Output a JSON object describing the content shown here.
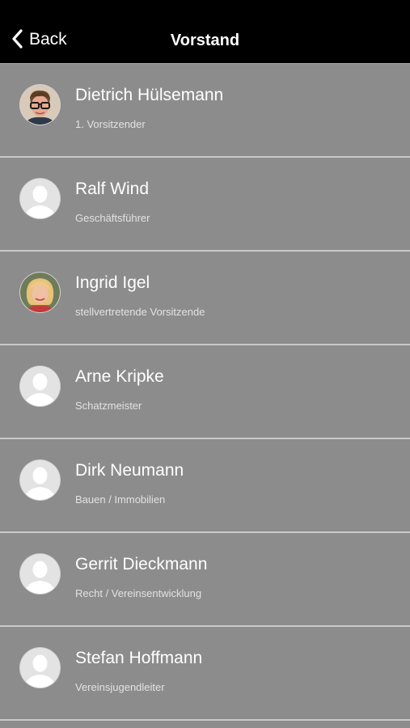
{
  "navbar": {
    "back_label": "Back",
    "title": "Vorstand"
  },
  "members": [
    {
      "name": "Dietrich Hülsemann",
      "role": "1. Vorsitzender",
      "avatar": "photo-man-glasses"
    },
    {
      "name": "Ralf Wind",
      "role": "Geschäftsführer",
      "avatar": "placeholder-person"
    },
    {
      "name": "Ingrid Igel",
      "role": "stellvertretende Vorsitzende",
      "avatar": "photo-woman-blonde"
    },
    {
      "name": "Arne Kripke",
      "role": "Schatzmeister",
      "avatar": "placeholder-person"
    },
    {
      "name": "Dirk Neumann",
      "role": "Bauen / Immobilien",
      "avatar": "placeholder-person"
    },
    {
      "name": "Gerrit Dieckmann",
      "role": "Recht / Vereinsentwicklung",
      "avatar": "placeholder-person"
    },
    {
      "name": "Stefan Hoffmann",
      "role": "Vereinsjugendleiter",
      "avatar": "placeholder-person"
    }
  ],
  "colors": {
    "navbar_bg": "#000000",
    "list_bg": "#8c8c8c",
    "separator": "#c9c9c9",
    "text_primary": "#ffffff",
    "text_secondary": "#e2e2e2"
  }
}
